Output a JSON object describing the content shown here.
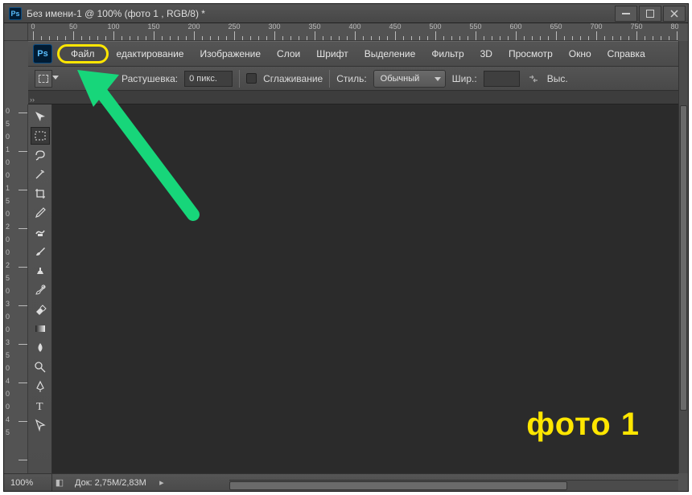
{
  "window": {
    "app_badge": "Ps",
    "title": "Без имени-1 @ 100% (фото 1 , RGB/8) *"
  },
  "menu": {
    "logo": "Ps",
    "items": [
      "Файл",
      "едактирование",
      "Изображение",
      "Слои",
      "Шрифт",
      "Выделение",
      "Фильтр",
      "3D",
      "Просмотр",
      "Окно",
      "Справка"
    ]
  },
  "options": {
    "feather_label": "Растушевка:",
    "feather_value": "0 пикс.",
    "antialias_label": "Сглаживание",
    "style_label": "Стиль:",
    "style_value": "Обычный",
    "width_label": "Шир.:",
    "height_label": "Выс."
  },
  "ruler_h": {
    "start": 0,
    "step": 50,
    "count": 17
  },
  "ruler_v_labels": [
    "0",
    "5",
    "0",
    "1",
    "0",
    "0",
    "1",
    "5",
    "0",
    "2",
    "0",
    "0",
    "2",
    "5",
    "0",
    "3",
    "0",
    "0",
    "3",
    "5",
    "0",
    "4",
    "0",
    "0",
    "4",
    "5"
  ],
  "status": {
    "zoom": "100%",
    "doc_info": "Док: 2,75M/2,83M"
  },
  "annotation": {
    "label": "фото 1"
  },
  "tools": [
    "move-tool",
    "rect-marquee-tool",
    "lasso-tool",
    "magic-wand-tool",
    "crop-tool",
    "eyedropper-tool",
    "spot-heal-tool",
    "brush-tool",
    "clone-stamp-tool",
    "history-brush-tool",
    "eraser-tool",
    "gradient-tool",
    "blur-tool",
    "dodge-tool",
    "pen-tool",
    "type-tool",
    "path-select-tool"
  ]
}
